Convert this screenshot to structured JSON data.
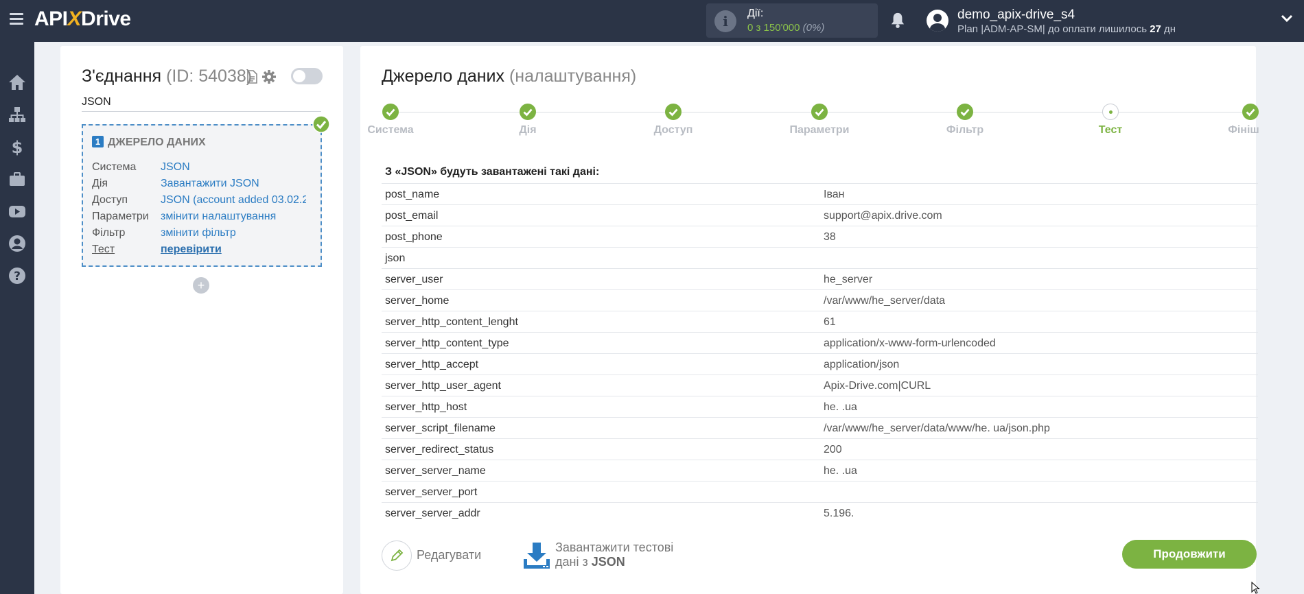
{
  "header": {
    "logo": {
      "part1": "API",
      "part2": "X",
      "part3": "Drive"
    },
    "actions": {
      "label": "Дії:",
      "value": "0 з 150'000",
      "percent": "(0%)"
    },
    "user": {
      "name": "demo_apix-drive_s4",
      "plan_prefix": "Plan |ADM-AP-SM| до оплати лишилось",
      "days": "27",
      "days_suffix": "дн"
    }
  },
  "sidebar": {
    "items": [
      "home-icon",
      "sitemap-icon",
      "dollar-icon",
      "briefcase-icon",
      "youtube-icon",
      "user-icon",
      "help-icon"
    ]
  },
  "connection": {
    "title": "З'єднання",
    "id": "(ID: 54038)",
    "name": "JSON",
    "source": {
      "number": "1",
      "heading": "ДЖЕРЕЛО ДАНИХ",
      "rows": [
        {
          "key": "Система",
          "value": "JSON"
        },
        {
          "key": "Дія",
          "value": "Завантажити JSON"
        },
        {
          "key": "Доступ",
          "value": "JSON (account added 03.02.2"
        },
        {
          "key": "Параметри",
          "value": "змінити налаштування"
        },
        {
          "key": "Фільтр",
          "value": "змінити фільтр"
        },
        {
          "key": "Тест",
          "value": "перевірити"
        }
      ]
    },
    "add_label": "+"
  },
  "main": {
    "title": "Джерело даних",
    "subtitle": "(налаштування)",
    "steps": [
      {
        "label": "Система",
        "state": "done"
      },
      {
        "label": "Дія",
        "state": "done"
      },
      {
        "label": "Доступ",
        "state": "done"
      },
      {
        "label": "Параметри",
        "state": "done"
      },
      {
        "label": "Фільтр",
        "state": "done"
      },
      {
        "label": "Тест",
        "state": "current"
      },
      {
        "label": "Фініш",
        "state": "done"
      }
    ],
    "table_heading": "З «JSON» будуть завантажені такі дані:",
    "rows": [
      {
        "key": "post_name",
        "value": "Іван"
      },
      {
        "key": "post_email",
        "value": "support@apix.drive.com"
      },
      {
        "key": "post_phone",
        "value": "38"
      },
      {
        "key": "json",
        "value": ""
      },
      {
        "key": "server_user",
        "value": "he_server"
      },
      {
        "key": "server_home",
        "value": "/var/www/he_server/data"
      },
      {
        "key": "server_http_content_lenght",
        "value": "61"
      },
      {
        "key": "server_http_content_type",
        "value": "application/x-www-form-urlencoded"
      },
      {
        "key": "server_http_accept",
        "value": "application/json"
      },
      {
        "key": "server_http_user_agent",
        "value": "Apix-Drive.com|CURL"
      },
      {
        "key": "server_http_host",
        "value": "he.          .ua"
      },
      {
        "key": "server_script_filename",
        "value": "/var/www/he_server/data/www/he.          ua/json.php"
      },
      {
        "key": "server_redirect_status",
        "value": "200"
      },
      {
        "key": "server_server_name",
        "value": "he.        .ua"
      },
      {
        "key": "server_server_port",
        "value": ""
      },
      {
        "key": "server_server_addr",
        "value": "5.196."
      }
    ],
    "edit_label": "Редагувати",
    "download_label_line1": "Завантажити тестові",
    "download_label_line2": "дані з",
    "download_label_bold": "JSON",
    "continue_label": "Продовжити"
  },
  "colors": {
    "topbar": "#2b3446",
    "accent_green": "#7cb342",
    "link_blue": "#2b7cc3"
  }
}
